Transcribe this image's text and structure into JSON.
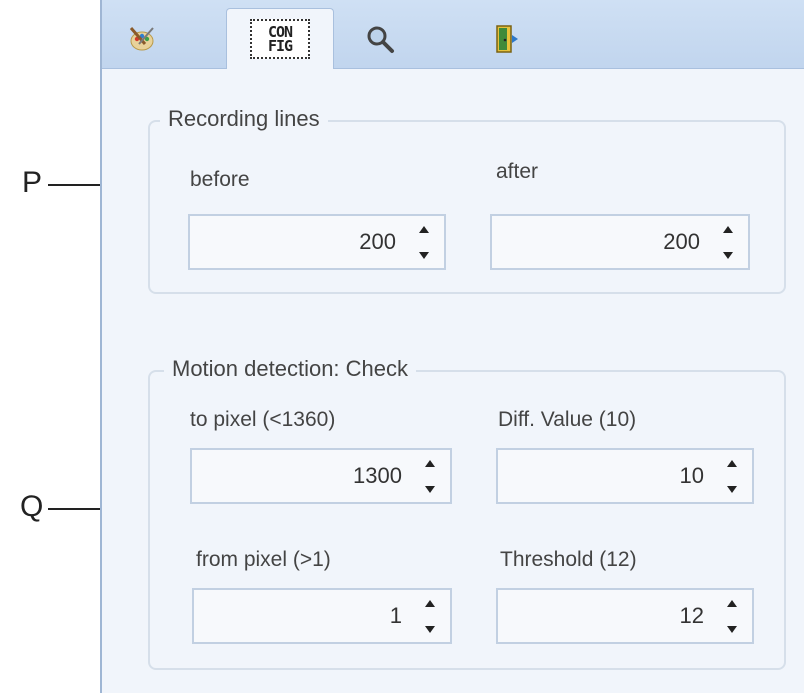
{
  "callouts": {
    "p": "P",
    "q": "Q"
  },
  "tabs": [
    {
      "icon": "brush-palette-icon"
    },
    {
      "icon": "config-icon",
      "text_top": "CON",
      "text_bottom": "FIG",
      "active": true
    },
    {
      "icon": "magnifier-icon"
    },
    {
      "icon": "exit-door-icon"
    }
  ],
  "recording": {
    "legend": "Recording lines",
    "before_label": "before",
    "after_label": "after",
    "before_value": "200",
    "after_value": "200"
  },
  "motion": {
    "legend": "Motion detection: Check",
    "to_pixel_label": "to pixel (<1360)",
    "diff_label": "Diff. Value (10)",
    "from_pixel_label": "from pixel (>1)",
    "threshold_label": "Threshold (12)",
    "to_pixel_value": "1300",
    "diff_value": "10",
    "from_pixel_value": "1",
    "threshold_value": "12"
  }
}
